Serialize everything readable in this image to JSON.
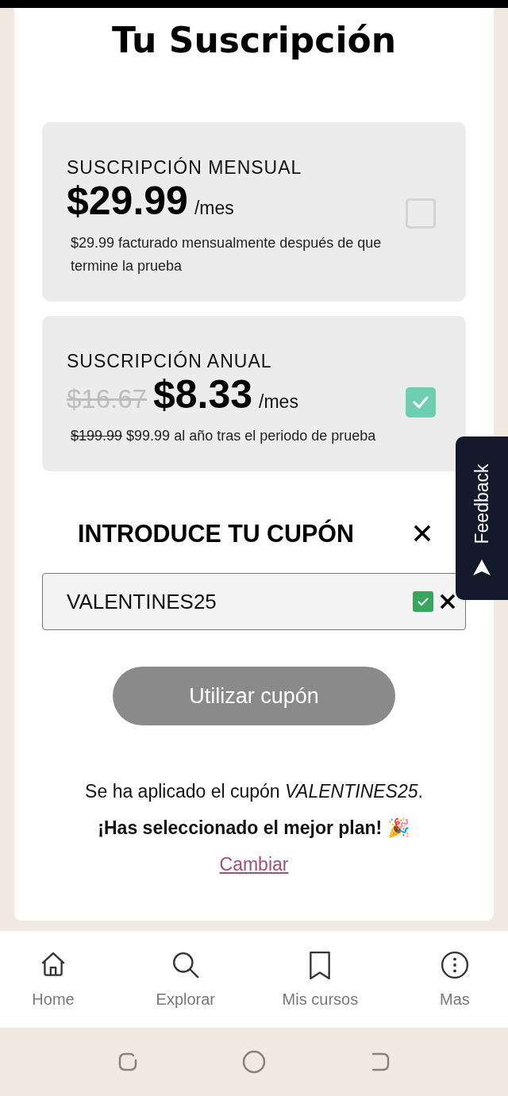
{
  "title": "Tu Suscripción",
  "plans": [
    {
      "name": "SUSCRIPCIÓN MENSUAL",
      "price": "$29.99",
      "unit": "/mes",
      "note": "$29.99 facturado mensualmente después de que termine la prueba",
      "selected": false
    },
    {
      "name": "SUSCRIPCIÓN ANUAL",
      "old_price": "$16.67",
      "price": "$8.33",
      "unit": "/mes",
      "old_note": "$199.99",
      "note": "$99.99 al año tras el periodo de prueba",
      "selected": true
    }
  ],
  "coupon": {
    "heading": "INTRODUCE TU CUPÓN",
    "value": "VALENTINES25",
    "valid": true,
    "button": "Utilizar cupón",
    "button_disabled": true
  },
  "messages": {
    "applied": "Se ha aplicado el cupón *VALENTINES25*.",
    "best": "¡Has seleccionado el mejor plan! 🎉",
    "link": "Cambiar"
  },
  "feedback": "Feedback",
  "nav": [
    {
      "label": "Home"
    },
    {
      "label": "Explorar"
    },
    {
      "label": "Mis cursos"
    },
    {
      "label": "Mas"
    }
  ]
}
